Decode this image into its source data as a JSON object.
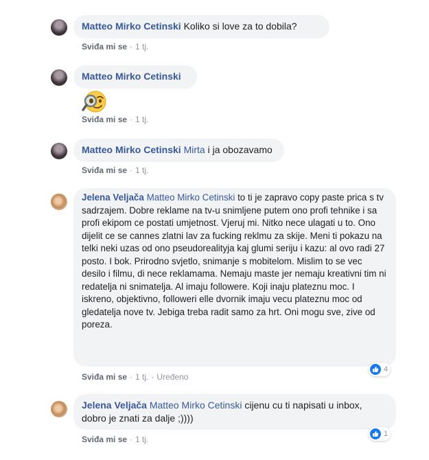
{
  "comments": [
    {
      "author": "Matteo Mirko Cetinski",
      "text": "Koliko si love za to dobila?",
      "like": "Sviđa mi se",
      "time": "1 tj."
    },
    {
      "author": "Matteo Mirko Cetinski",
      "sticker": "magnifying-glass-face-emoji",
      "like": "Sviđa mi se",
      "time": "1 tj."
    },
    {
      "author": "Matteo Mirko Cetinski",
      "mention": "Mirta",
      "text": "i ja obozavamo",
      "like": "Sviđa mi se",
      "time": "1 tj."
    },
    {
      "author": "Jelena Veljača",
      "mention": "Matteo Mirko Cetinski",
      "text": "to ti je zapravo copy paste prica s tv sadrzajem. Dobre reklame na tv-u snimljene putem ono profi tehnike i sa profi ekipom ce postati umjetnost. Vjeruj mi. Nitko nece ulagati u to. Ono dijelit ce se cannes zlatni lav za fucking reklmu za skije. Meni ti pokazu na telki neki uzas od ono pseudorealityja kaj glumi seriju i kazu: al ovo radi 27 posto. I bok. Prirodno svjetlo, snimanje s mobitelom. Mislim to se vec desilo i filmu, di nece reklamama. Nemaju maste jer nemaju kreativni tim ni redatelja ni snimatelja. Al imaju followere. Koji inaju plateznu moc. I iskreno, objektivno, followeri elle dvornik imaju vecu plateznu moc od gledatelja nove tv. Jebiga treba radit samo za hrt. Oni mogu sve, zive od poreza.",
      "like": "Sviđa mi se",
      "time": "1 tj.",
      "edited": "Uređeno",
      "reaction_count": "4"
    },
    {
      "author": "Jelena Veljača",
      "mention": "Matteo Mirko Cetinski",
      "text": "cijenu cu ti napisati u inbox, dobro je znati za dalje ;))))",
      "like": "Sviđa mi se",
      "time": "1 tj.",
      "reaction_count": "1"
    }
  ],
  "dot": "·",
  "colors": {
    "link": "#385898",
    "bubble": "#f2f3f5",
    "like_blue": "#1877f2"
  }
}
